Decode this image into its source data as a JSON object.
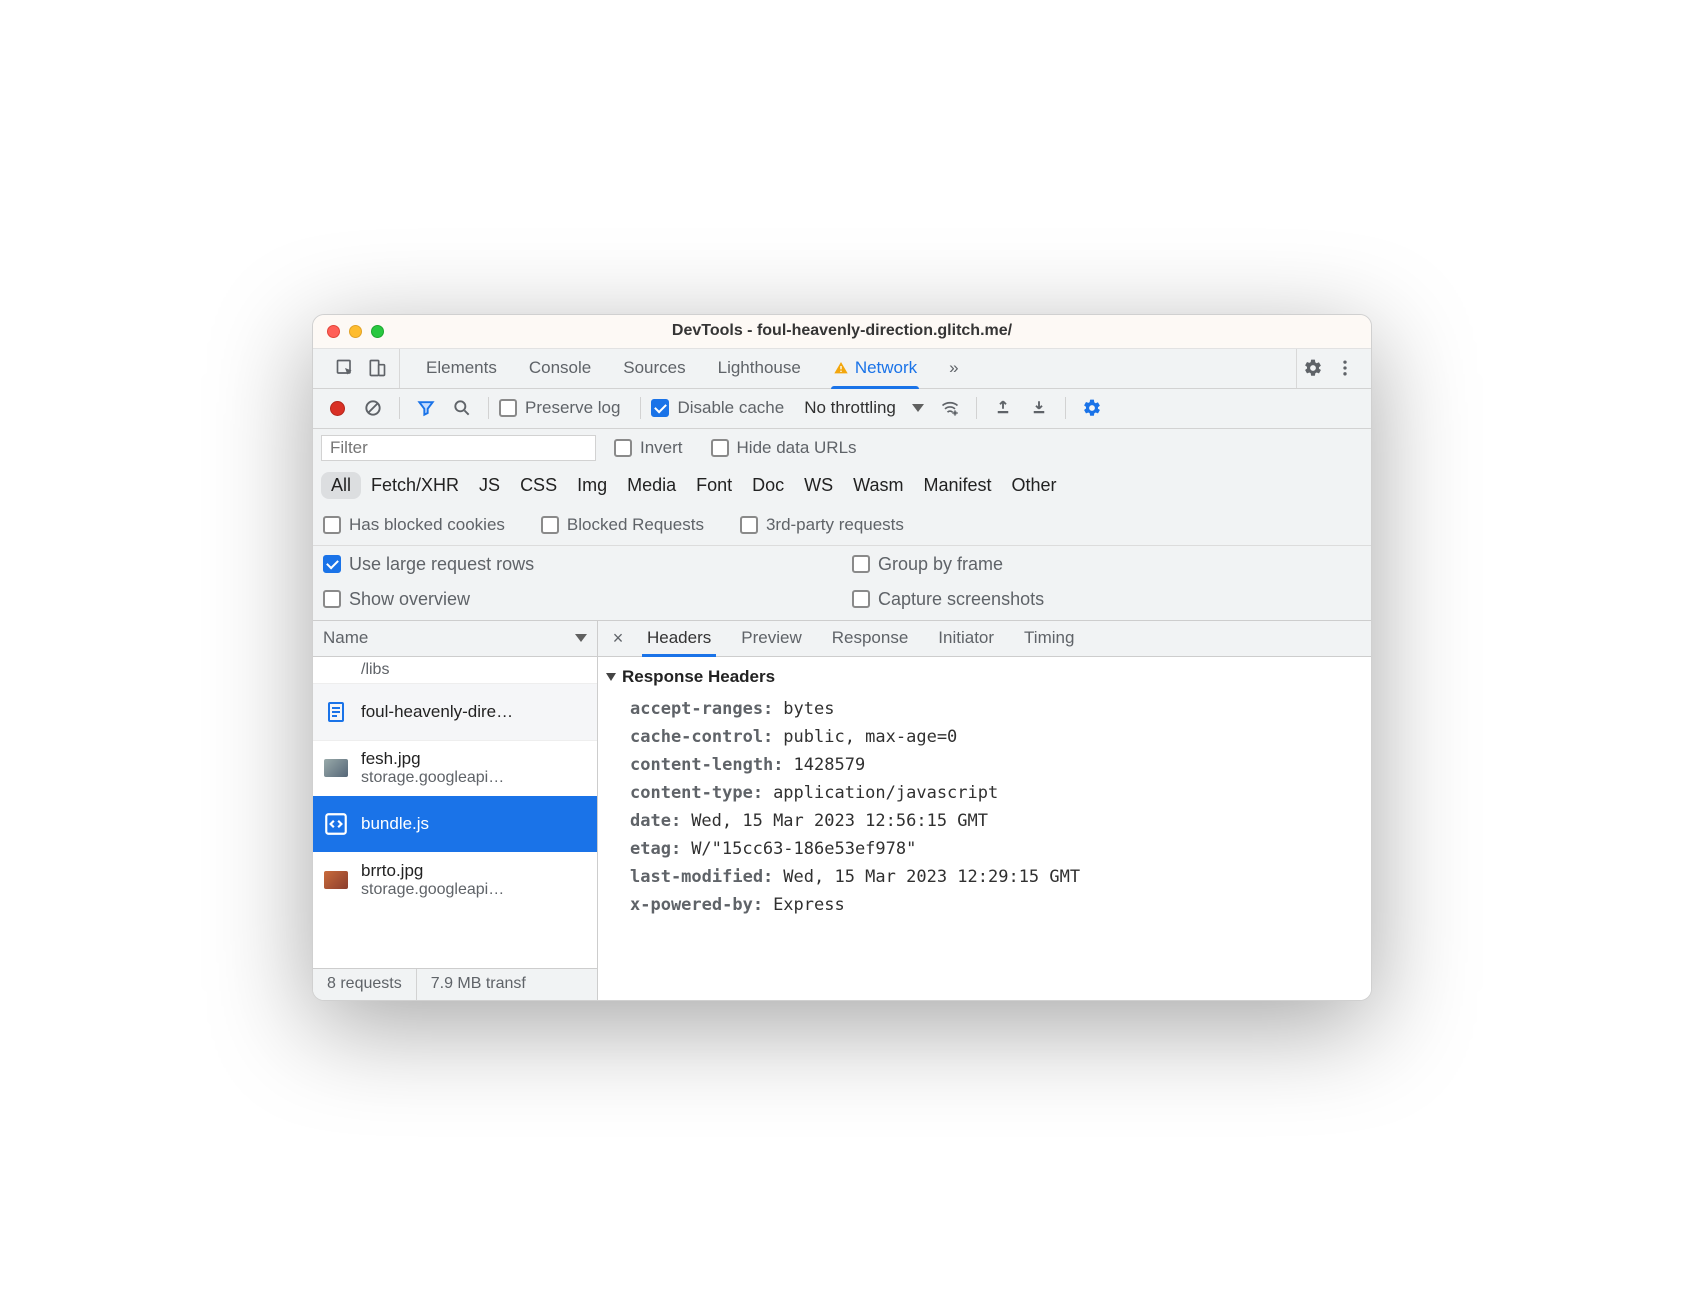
{
  "window": {
    "title": "DevTools - foul-heavenly-direction.glitch.me/"
  },
  "tabs": {
    "items": [
      "Elements",
      "Console",
      "Sources",
      "Lighthouse",
      "Network"
    ],
    "active": "Network",
    "more": "»"
  },
  "toolbar": {
    "preserve_log": "Preserve log",
    "disable_cache": "Disable cache",
    "throttling": "No throttling"
  },
  "filter": {
    "placeholder": "Filter",
    "invert": "Invert",
    "hide_data_urls": "Hide data URLs",
    "types": [
      "All",
      "Fetch/XHR",
      "JS",
      "CSS",
      "Img",
      "Media",
      "Font",
      "Doc",
      "WS",
      "Wasm",
      "Manifest",
      "Other"
    ],
    "has_blocked_cookies": "Has blocked cookies",
    "blocked_requests": "Blocked Requests",
    "third_party": "3rd-party requests"
  },
  "options": {
    "large_rows": "Use large request rows",
    "group_by_frame": "Group by frame",
    "show_overview": "Show overview",
    "capture_screenshots": "Capture screenshots"
  },
  "requests": {
    "column": "Name",
    "truncated_top": "/libs",
    "rows": [
      {
        "name": "foul-heavenly-dire…",
        "sub": "",
        "icon": "document"
      },
      {
        "name": "fesh.jpg",
        "sub": "storage.googleapi…",
        "icon": "thumb-a"
      },
      {
        "name": "bundle.js",
        "sub": "",
        "icon": "script",
        "selected": true
      },
      {
        "name": "brrto.jpg",
        "sub": "storage.googleapi…",
        "icon": "thumb-b"
      }
    ]
  },
  "detail": {
    "tabs": [
      "Headers",
      "Preview",
      "Response",
      "Initiator",
      "Timing"
    ],
    "active": "Headers",
    "section": "Response Headers",
    "headers": [
      {
        "k": "accept-ranges:",
        "v": "bytes"
      },
      {
        "k": "cache-control:",
        "v": "public, max-age=0"
      },
      {
        "k": "content-length:",
        "v": "1428579"
      },
      {
        "k": "content-type:",
        "v": "application/javascript"
      },
      {
        "k": "date:",
        "v": "Wed, 15 Mar 2023 12:56:15 GMT"
      },
      {
        "k": "etag:",
        "v": "W/\"15cc63-186e53ef978\""
      },
      {
        "k": "last-modified:",
        "v": "Wed, 15 Mar 2023 12:29:15 GMT"
      },
      {
        "k": "x-powered-by:",
        "v": "Express"
      }
    ]
  },
  "status": {
    "requests": "8 requests",
    "transfer": "7.9 MB transf"
  }
}
